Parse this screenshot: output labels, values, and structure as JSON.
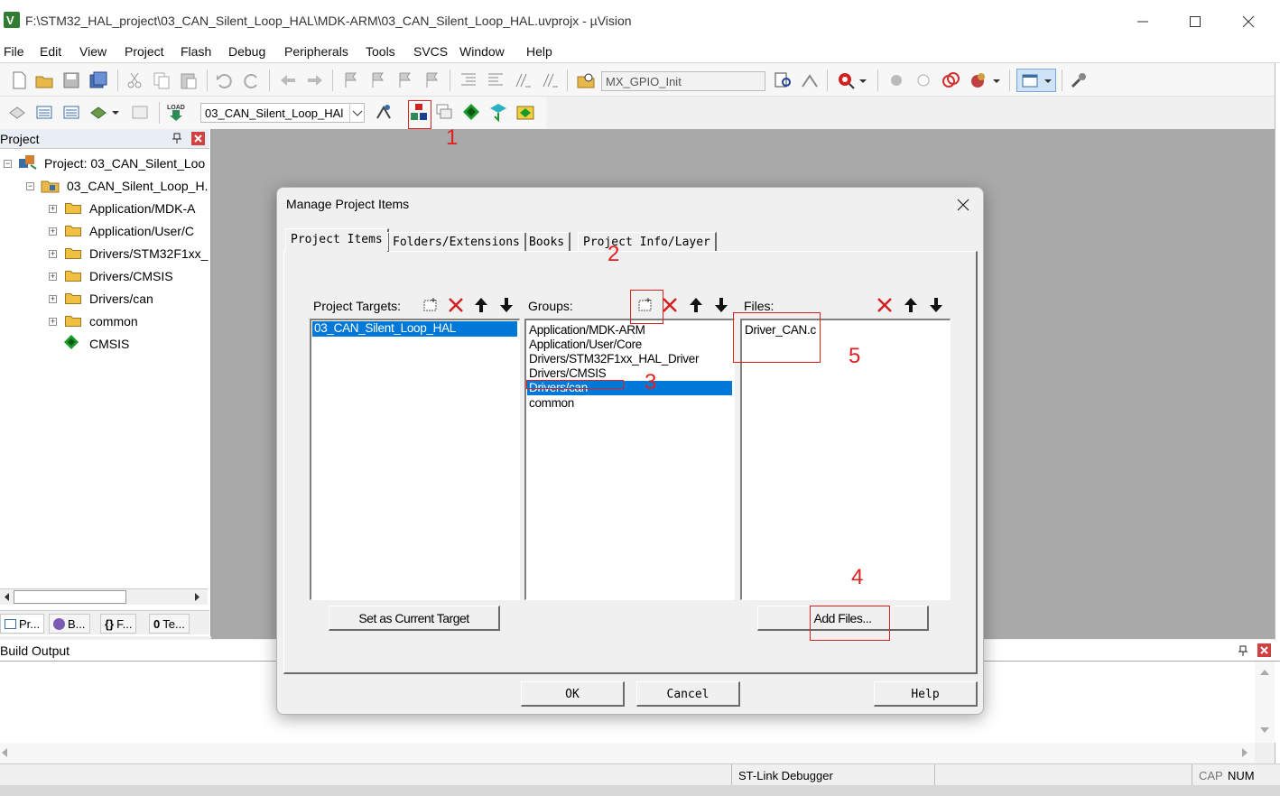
{
  "window": {
    "title": "F:\\STM32_HAL_project\\03_CAN_Silent_Loop_HAL\\MDK-ARM\\03_CAN_Silent_Loop_HAL.uvprojx - µVision"
  },
  "menu": [
    "File",
    "Edit",
    "View",
    "Project",
    "Flash",
    "Debug",
    "Peripherals",
    "Tools",
    "SVCS",
    "Window",
    "Help"
  ],
  "toolbar": {
    "function_combo": "MX_GPIO_Init",
    "target_combo": "03_CAN_Silent_Loop_HAl"
  },
  "project_pane": {
    "title": "Project",
    "root": "Project: 03_CAN_Silent_Loo",
    "target": "03_CAN_Silent_Loop_H.",
    "groups": [
      "Application/MDK-A",
      "Application/User/C",
      "Drivers/STM32F1xx_",
      "Drivers/CMSIS",
      "Drivers/can",
      "common"
    ],
    "cmsis": "CMSIS",
    "tabs": [
      "Pr...",
      "B...",
      "F...",
      "Te..."
    ],
    "tab_prefixes": [
      "{}",
      "0"
    ]
  },
  "build_output": {
    "title": "Build Output"
  },
  "status": {
    "debugger": "ST-Link Debugger",
    "cap": "CAP",
    "num": "NUM"
  },
  "dialog": {
    "title": "Manage Project Items",
    "tabs": [
      "Project Items",
      "Folders/Extensions",
      "Books",
      "Project Info/Layer"
    ],
    "targets_label": "Project Targets:",
    "groups_label": "Groups:",
    "files_label": "Files:",
    "targets": [
      "03_CAN_Silent_Loop_HAL"
    ],
    "groups": [
      "Application/MDK-ARM",
      "Application/User/Core",
      "Drivers/STM32F1xx_HAL_Driver",
      "Drivers/CMSIS",
      "Drivers/can",
      "common"
    ],
    "selected_group": "Drivers/can",
    "files": [
      "Driver_CAN.c"
    ],
    "set_target_button": "Set as Current Target",
    "add_files_button": "Add Files...",
    "ok_button": "OK",
    "cancel_button": "Cancel",
    "help_button": "Help"
  },
  "annotations": [
    "1",
    "2",
    "3",
    "4",
    "5"
  ],
  "colors": {
    "accent": "#0078d7",
    "annotation": "#e02020",
    "workspace": "#a9a9a9"
  }
}
